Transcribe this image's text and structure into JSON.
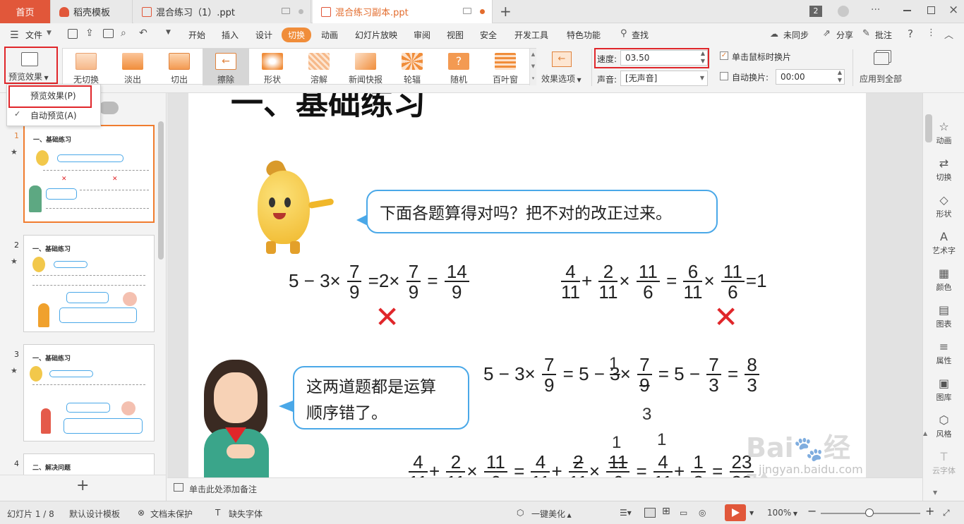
{
  "titlebar": {
    "home": "首页",
    "tab1": "稻壳模板",
    "tab2": "混合练习（1）.ppt",
    "tab3": "混合练习副本.ppt",
    "badge": "2"
  },
  "menubar": {
    "file": "文件",
    "items": [
      "开始",
      "插入",
      "设计",
      "切换",
      "动画",
      "幻灯片放映",
      "审阅",
      "视图",
      "安全",
      "开发工具",
      "特色功能"
    ],
    "search": "查找",
    "sync": "未同步",
    "share": "分享",
    "comment": "批注"
  },
  "ribbon": {
    "preview": "预览效果",
    "effects": [
      "无切换",
      "淡出",
      "切出",
      "擦除",
      "形状",
      "溶解",
      "新闻快报",
      "轮辐",
      "随机",
      "百叶窗"
    ],
    "effect_options": "效果选项",
    "speed_label": "速度:",
    "speed_value": "03.50",
    "sound_label": "声音:",
    "sound_value": "[无声音]",
    "click_change": "单击鼠标时换片",
    "auto_change": "自动换片:",
    "auto_time": "00:00",
    "apply_all": "应用到全部"
  },
  "dropdown": {
    "item1": "预览效果(P)",
    "item2": "自动预览(A)"
  },
  "slides": {
    "nums": [
      "1",
      "2",
      "3",
      "4"
    ],
    "titles": [
      "一、基础练习",
      "一、基础练习",
      "一、基础练习",
      "二、解决问题"
    ]
  },
  "slide": {
    "title": "一、基础练习",
    "bubble1": "下面各题算得对吗？把不对的改正过来。",
    "bubble2_line1": "这两道题都是运算",
    "bubble2_line2": "顺序错了。"
  },
  "rightbar": [
    "动画",
    "切换",
    "形状",
    "艺术字",
    "颜色",
    "图表",
    "属性",
    "图库",
    "风格",
    "云字体"
  ],
  "notes": "单击此处添加备注",
  "status": {
    "slide": "幻灯片 1 / 8",
    "template": "默认设计模板",
    "protect": "文档未保护",
    "font": "缺失字体",
    "beautify": "一键美化",
    "zoom": "100%"
  },
  "watermark": "Baidu经验 jingyan.baidu.com",
  "colors": {
    "accent": "#e1573a",
    "active_menu": "#f08d3a",
    "highlight": "#e0262a",
    "bubble_border": "#4aa8e8"
  }
}
